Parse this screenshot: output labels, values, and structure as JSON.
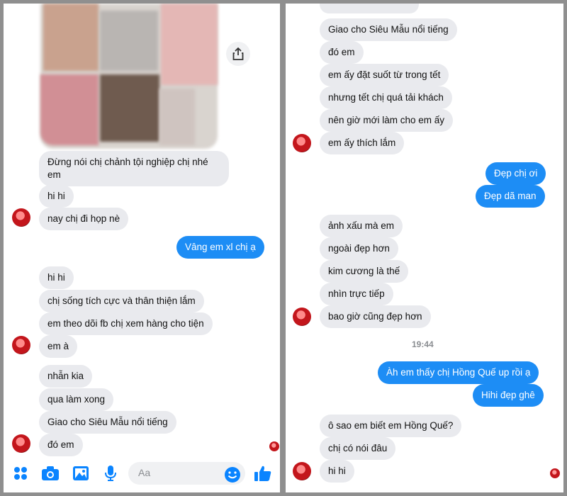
{
  "left": {
    "messages": [
      {
        "text": "Đừng nói chị chảnh tội nghiệp chị nhé em",
        "side": "in"
      },
      {
        "text": "hi hi",
        "side": "in"
      },
      {
        "text": "nay chị đi họp nè",
        "side": "in"
      },
      {
        "text": "Vâng em xl chị ạ",
        "side": "out"
      },
      {
        "text": "hi hi",
        "side": "in"
      },
      {
        "text": "chị sống tích cực và thân thiện lắm",
        "side": "in"
      },
      {
        "text": "em theo dõi fb chị xem hàng cho tiện",
        "side": "in"
      },
      {
        "text": "em à",
        "side": "in"
      },
      {
        "text": "nhẫn kia",
        "side": "in"
      },
      {
        "text": "qua làm xong",
        "side": "in"
      },
      {
        "text": "Giao cho Siêu Mẫu nổi tiếng",
        "side": "in"
      },
      {
        "text": "đó em",
        "side": "in"
      }
    ],
    "composer": {
      "placeholder": "Aa"
    }
  },
  "right": {
    "messages": [
      {
        "text": "Giao cho Siêu Mẫu nổi tiếng",
        "side": "in"
      },
      {
        "text": "đó em",
        "side": "in"
      },
      {
        "text": "em ấy đặt suốt từ trong tết",
        "side": "in"
      },
      {
        "text": "nhưng tết chị quá tải khách",
        "side": "in"
      },
      {
        "text": "nên giờ mới làm cho em ấy",
        "side": "in"
      },
      {
        "text": "em ấy thích lắm",
        "side": "in"
      },
      {
        "text": "Đẹp chị ơi",
        "side": "out"
      },
      {
        "text": "Đẹp dã man",
        "side": "out"
      },
      {
        "text": "ảnh xấu mà em",
        "side": "in"
      },
      {
        "text": "ngoài đẹp hơn",
        "side": "in"
      },
      {
        "text": "kim cương là thế",
        "side": "in"
      },
      {
        "text": "nhìn trực tiếp",
        "side": "in"
      },
      {
        "text": "bao giờ cũng đẹp hơn",
        "side": "in"
      },
      {
        "text": "Àh em thấy chị Hồng Quế up rồi ạ",
        "side": "out"
      },
      {
        "text": "Hihi đẹp ghê",
        "side": "out"
      },
      {
        "text": "ô sao em biết em Hồng Quế?",
        "side": "in"
      },
      {
        "text": "chị có nói đâu",
        "side": "in"
      },
      {
        "text": "hi hi",
        "side": "in"
      }
    ],
    "timestamp": "19:44"
  },
  "colors": {
    "incoming_bubble": "#e9eaee",
    "outgoing_bubble": "#1d8df5",
    "accent": "#0a84ff"
  },
  "icons": [
    "menu-dots-icon",
    "camera-icon",
    "gallery-icon",
    "microphone-icon",
    "emoji-icon",
    "thumbs-up-icon",
    "share-icon"
  ]
}
